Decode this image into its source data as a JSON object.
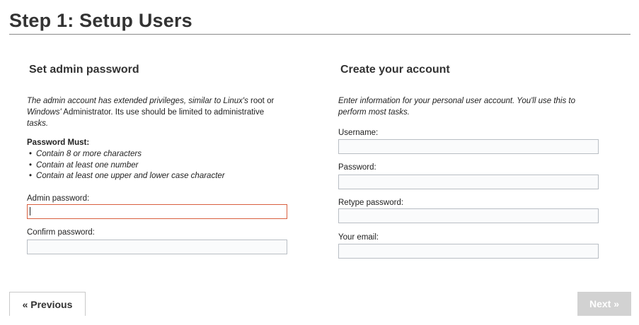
{
  "page": {
    "title": "Step 1: Setup Users"
  },
  "admin": {
    "heading": "Set admin password",
    "desc_1": "The admin account has extended privileges, similar to Linux's",
    "desc_2": " root or",
    "desc_3": "Windows'",
    "desc_4": " Administrator. Its use should be limited to administrative",
    "desc_5": "tasks.",
    "requirements_title": "Password Must:",
    "requirements": [
      "Contain 8 or more characters",
      "Contain at least one number",
      "Contain at least one upper and lower case character"
    ],
    "password_label": "Admin password:",
    "password_value": "",
    "confirm_label": "Confirm password:",
    "confirm_value": ""
  },
  "account": {
    "heading": "Create your account",
    "desc_1": "Enter information for your personal user account. You'll use this to",
    "desc_2": "perform most tasks.",
    "username_label": "Username:",
    "username_value": "",
    "password_label": "Password:",
    "password_value": "",
    "retype_label": "Retype password:",
    "retype_value": "",
    "email_label": "Your email:",
    "email_value": ""
  },
  "nav": {
    "previous_label": "« Previous",
    "next_label": "Next »"
  },
  "colors": {
    "error_border": "#d9603f",
    "disabled_button": "#d2d2d2"
  }
}
